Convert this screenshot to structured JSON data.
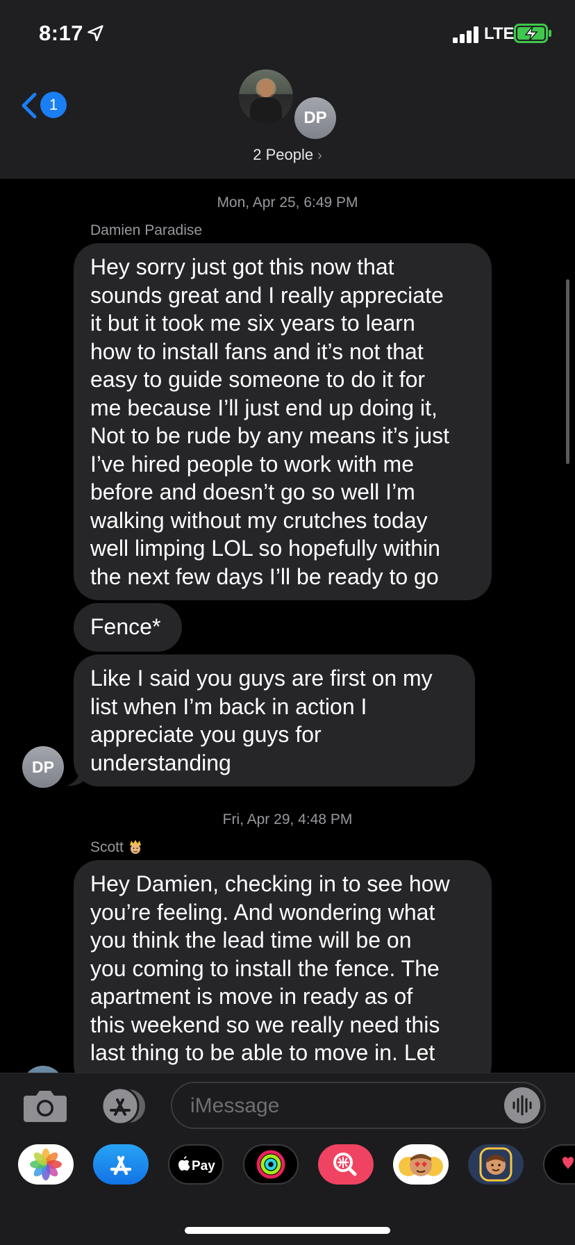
{
  "status": {
    "time": "8:17",
    "network": "LTE"
  },
  "header": {
    "back_badge": "1",
    "group_avatar_initials": "DP",
    "people_label": "2 People",
    "people_chevron": "›"
  },
  "messages": [
    {
      "timestamp": "Mon, Apr 25, 6:49 PM",
      "sender": "Damien Paradise",
      "bubbles": [
        [
          "Hey sorry just got this now that",
          "sounds great and I really appreciate",
          "it but it took me six years to learn",
          "how to install fans and it’s not that",
          "easy to guide someone to do it for",
          "me because I’ll just end up doing it,",
          "Not to be rude by any means it’s just",
          "I’ve hired people to work with me",
          "before and doesn’t go so well I’m",
          "walking without my crutches today",
          "well limping LOL so hopefully within",
          "the next few days I’ll be ready to go"
        ],
        [
          "Fence*"
        ],
        [
          "Like I said you guys are first on my",
          "list when I’m back in action I",
          "appreciate you guys for",
          "understanding"
        ]
      ],
      "avatar_initials": "DP"
    },
    {
      "timestamp": "Fri, Apr 29, 4:48 PM",
      "sender": "Scott",
      "sender_emoji_icon": "crown-face-icon",
      "bubbles": [
        [
          "Hey Damien, checking in to see how",
          "you’re feeling. And wondering what",
          "you think the lead time will be on",
          "you coming to install the fence. The",
          "apartment is move in ready as of",
          "this weekend so we really need this",
          "last thing to be able to move in. Let"
        ]
      ]
    }
  ],
  "input": {
    "placeholder": "iMessage"
  },
  "drawer": {
    "apps": [
      "photos-icon",
      "app-store-icon",
      "apple-pay-icon",
      "activity-icon",
      "image-search-icon",
      "memoji-icon",
      "memoji-stickers-icon",
      "digital-touch-icon"
    ],
    "apple_pay_label": "Pay"
  },
  "colors": {
    "accent": "#1a7ef5",
    "bubble_received": "#262629",
    "background": "#000000",
    "header": "#1f1f21"
  }
}
